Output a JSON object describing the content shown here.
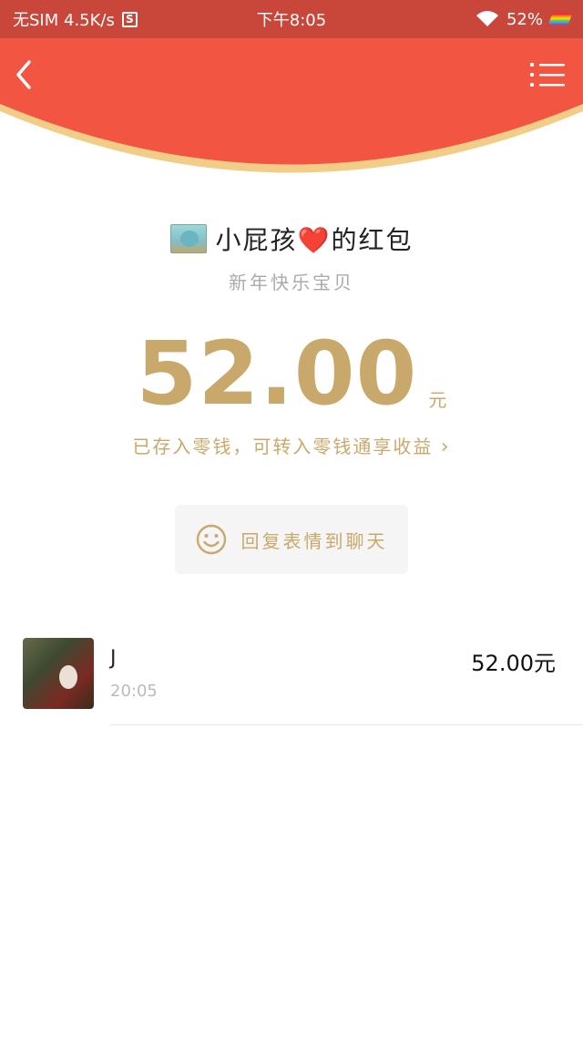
{
  "status_bar": {
    "carrier": "无SIM 4.5K/s",
    "sim_badge": "S",
    "time": "下午8:05",
    "battery": "52%"
  },
  "header": {
    "back_icon": "chevron-left-icon",
    "menu_icon": "list-menu-icon",
    "color": "#f25542"
  },
  "sender": {
    "name_prefix": "小屁孩",
    "heart": "❤️",
    "name_suffix": "的红包",
    "greeting": "新年快乐宝贝"
  },
  "amount": {
    "value": "52.00",
    "unit": "元",
    "note": "已存入零钱，可转入零钱通享收益",
    "note_chevron": "›",
    "accent_color": "#c9a86c"
  },
  "reply": {
    "icon": "smiley-icon",
    "label": "回复表情到聊天"
  },
  "records": [
    {
      "name": "J",
      "time": "20:05",
      "amount": "52.00元"
    }
  ]
}
